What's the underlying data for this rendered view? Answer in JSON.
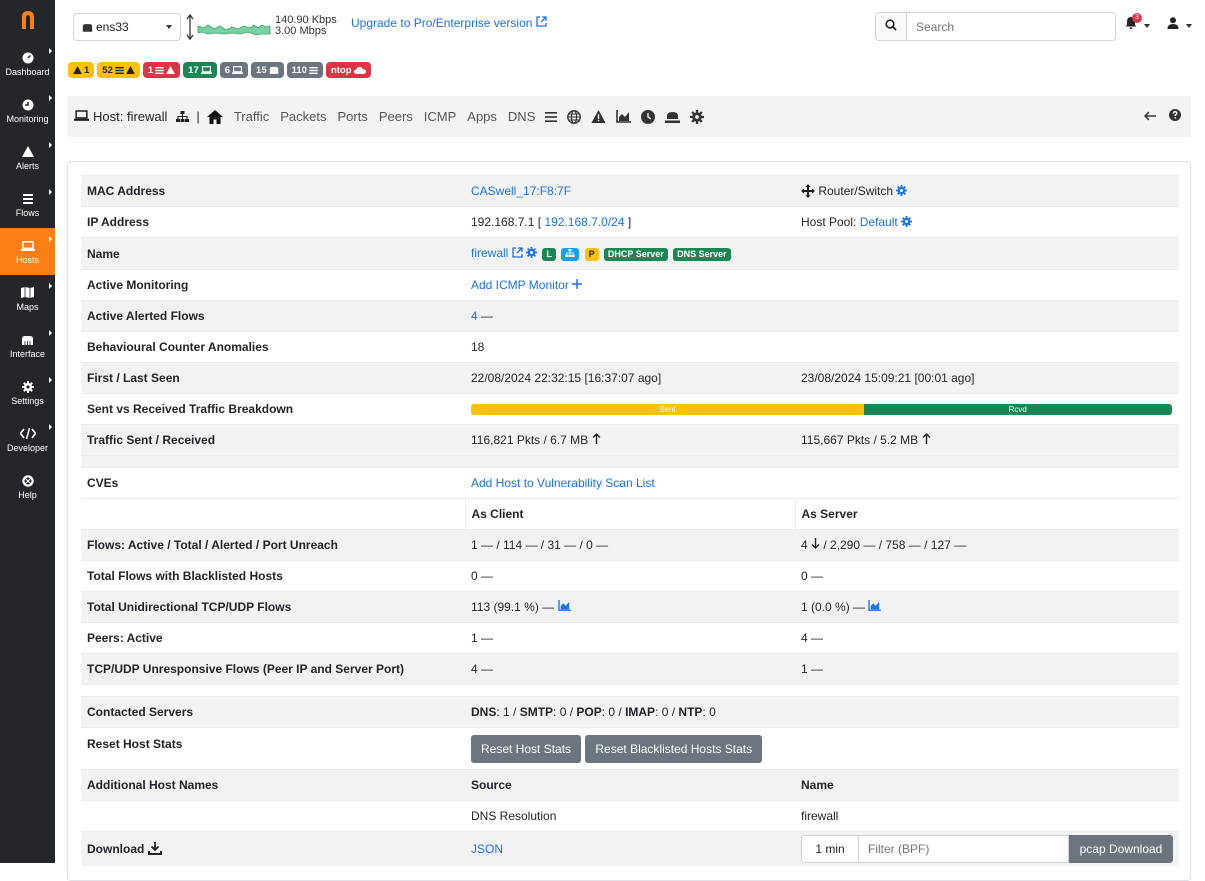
{
  "colors": {
    "sidebar_bg": "#23272b",
    "accent": "#fd7e14",
    "link": "#1a73e8",
    "success": "#198754",
    "warning": "#ffc107",
    "danger": "#dc3545",
    "secondary": "#6c757d"
  },
  "sidebar": {
    "logo_icon": "ntopng-logo",
    "items": [
      {
        "label": "Dashboard",
        "icon": "gauge-icon"
      },
      {
        "label": "Monitoring",
        "icon": "monitoring-icon"
      },
      {
        "label": "Alerts",
        "icon": "warning-icon"
      },
      {
        "label": "Flows",
        "icon": "stream-icon"
      },
      {
        "label": "Hosts",
        "icon": "laptop-icon",
        "active": true
      },
      {
        "label": "Maps",
        "icon": "map-icon"
      },
      {
        "label": "Interface",
        "icon": "ethernet-icon"
      },
      {
        "label": "Settings",
        "icon": "cog-icon"
      },
      {
        "label": "Developer",
        "icon": "code-icon"
      },
      {
        "label": "Help",
        "icon": "lifebuoy-icon"
      }
    ]
  },
  "topbar": {
    "interface": "ens33",
    "upload_rate": "140.90 Kbps",
    "download_rate": "3.00 Mbps",
    "upgrade_text": "Upgrade to Pro/Enterprise version",
    "search_placeholder": "Search",
    "notification_count": "3"
  },
  "status_badges": [
    {
      "text": "1",
      "icon": "warning-icon",
      "style": "yellow"
    },
    {
      "text": "52",
      "icon": "stream-warning-icon",
      "style": "yellow"
    },
    {
      "text": "1",
      "icon": "stream-warning-icon",
      "style": "red"
    },
    {
      "text": "17",
      "icon": "laptop-icon",
      "style": "green"
    },
    {
      "text": "6",
      "icon": "laptop-icon",
      "style": "grey"
    },
    {
      "text": "15",
      "icon": "ethernet-icon",
      "style": "grey"
    },
    {
      "text": "110",
      "icon": "stream-icon",
      "style": "grey"
    },
    {
      "text": "ntop",
      "icon": "cloud-icon",
      "style": "red"
    }
  ],
  "host_nav": {
    "title": "Host: firewall",
    "links": [
      "Traffic",
      "Packets",
      "Ports",
      "Peers",
      "ICMP",
      "Apps",
      "DNS"
    ]
  },
  "host": {
    "mac_label": "MAC Address",
    "mac": "CASwell_17:F8:7F",
    "device_type": "Router/Switch",
    "ip_label": "IP Address",
    "ip": "192.168.7.1",
    "ip_bracket_open": "[",
    "network": "192.168.7.0/24",
    "ip_bracket_close": "]",
    "host_pool_label": "Host Pool:",
    "host_pool": "Default",
    "name_label": "Name",
    "name": "firewall",
    "tag_l": "L",
    "tag_p": "P",
    "tag_dhcp": "DHCP Server",
    "tag_dns": "DNS Server",
    "active_monitoring_label": "Active Monitoring",
    "add_icmp": "Add ICMP Monitor",
    "alerted_flows_label": "Active Alerted Flows",
    "alerted_flows": "4",
    "anomalies_label": "Behavioural Counter Anomalies",
    "anomalies": "18",
    "seen_label": "First / Last Seen",
    "first_seen": "22/08/2024 22:32:15 [16:37:07 ago]",
    "last_seen": "23/08/2024 15:09:21 [00:01 ago]",
    "breakdown_label": "Sent vs Received Traffic Breakdown",
    "sent_label": "Sent",
    "rcvd_label": "Rcvd",
    "sent_fraction": 0.56,
    "traffic_label": "Traffic Sent / Received",
    "traffic_sent": "116,821 Pkts / 6.7 MB",
    "traffic_rcvd": "115,667 Pkts / 5.2 MB",
    "cves_label": "CVEs",
    "add_vuln": "Add Host to Vulnerability Scan List",
    "as_client": "As Client",
    "as_server": "As Server",
    "flows_label": "Flows: Active / Total / Alerted / Port Unreach",
    "flows_client": "1 — / 114 — / 31 — / 0 —",
    "flows_server_a": "4",
    "flows_server_b": "/ 2,290 — / 758 — / 127 —",
    "blacklisted_label": "Total Flows with Blacklisted Hosts",
    "blacklisted_client": "0 —",
    "blacklisted_server": "0 —",
    "unidir_label": "Total Unidirectional TCP/UDP Flows",
    "unidir_client": "113 (99.1 %) —",
    "unidir_server": "1 (0.0 %) —",
    "peers_label": "Peers: Active",
    "peers_client": "1 —",
    "peers_server": "4 —",
    "unresp_label": "TCP/UDP Unresponsive Flows (Peer IP and Server Port)",
    "unresp_client": "4 —",
    "unresp_server": "1 —",
    "contacted_label": "Contacted Servers",
    "dns_k": "DNS",
    "dns_v": ": 1 / ",
    "smtp_k": "SMTP",
    "smtp_v": ": 0 / ",
    "pop_k": "POP",
    "pop_v": ": 0 / ",
    "imap_k": "IMAP",
    "imap_v": ": 0 / ",
    "ntp_k": "NTP",
    "ntp_v": ": 0",
    "reset_label": "Reset Host Stats",
    "reset_btn": "Reset Host Stats",
    "reset_bl_btn": "Reset Blacklisted Hosts Stats",
    "additional_label": "Additional Host Names",
    "source_hdr": "Source",
    "name_hdr": "Name",
    "source_value": "DNS Resolution",
    "name_value": "firewall",
    "download_label": "Download",
    "json_link": "JSON",
    "pcap_duration": "1 min",
    "bpf_placeholder": "Filter (BPF)",
    "pcap_button": "pcap Download"
  }
}
